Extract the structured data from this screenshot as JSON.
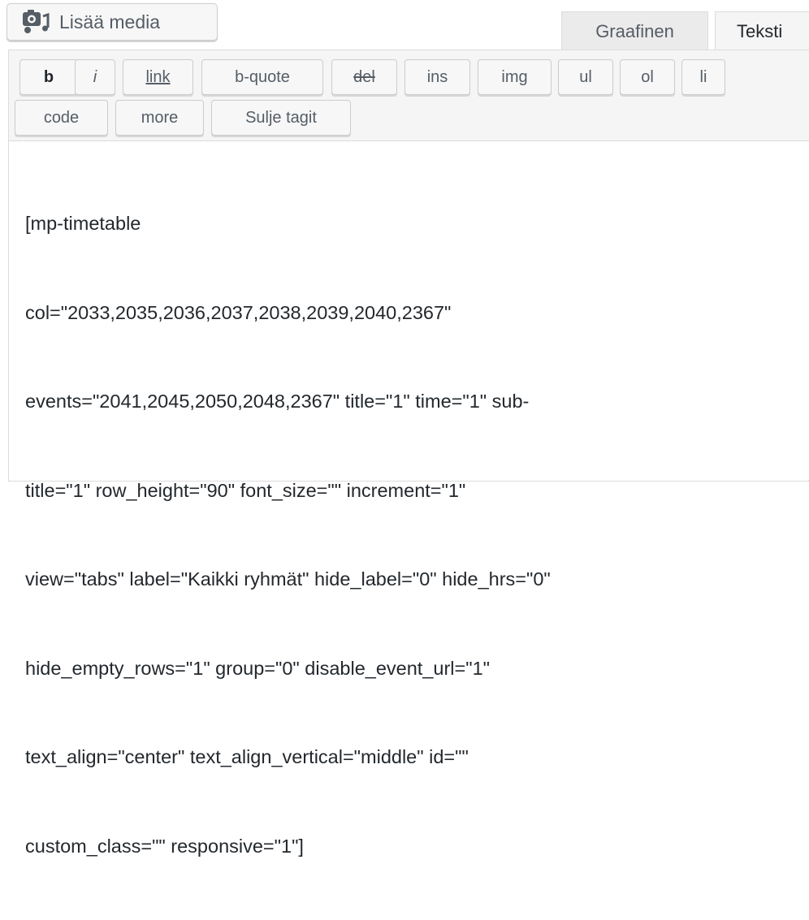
{
  "media_button": {
    "label": "Lisää media",
    "icon": "add-media-icon"
  },
  "tabs": [
    {
      "label": "Graafinen",
      "active": false
    },
    {
      "label": "Teksti",
      "active": true
    }
  ],
  "quicktags": {
    "row1": [
      "b",
      "i",
      "link",
      "b-quote",
      "del",
      "ins",
      "img",
      "ul",
      "ol",
      "li"
    ],
    "row2": [
      "code",
      "more",
      "Sulje tagit"
    ]
  },
  "editor": {
    "lines": [
      "[mp-timetable",
      "col=\"2033,2035,2036,2037,2038,2039,2040,2367\"",
      "events=\"2041,2045,2050,2048,2367\" title=\"1\" time=\"1\" sub-",
      "title=\"1\" row_height=\"90\" font_size=\"\" increment=\"1\"",
      "view=\"tabs\" label=\"Kaikki ryhmät\" hide_label=\"0\" hide_hrs=\"0\"",
      "hide_empty_rows=\"1\" group=\"0\" disable_event_url=\"1\"",
      "text_align=\"center\" text_align_vertical=\"middle\" id=\"\"",
      "custom_class=\"\" responsive=\"1\"]"
    ]
  },
  "colors": {
    "toolbar_bg": "#f5f5f5",
    "border": "#dcdcde",
    "text": "#23282d",
    "button_text": "#555d66"
  }
}
